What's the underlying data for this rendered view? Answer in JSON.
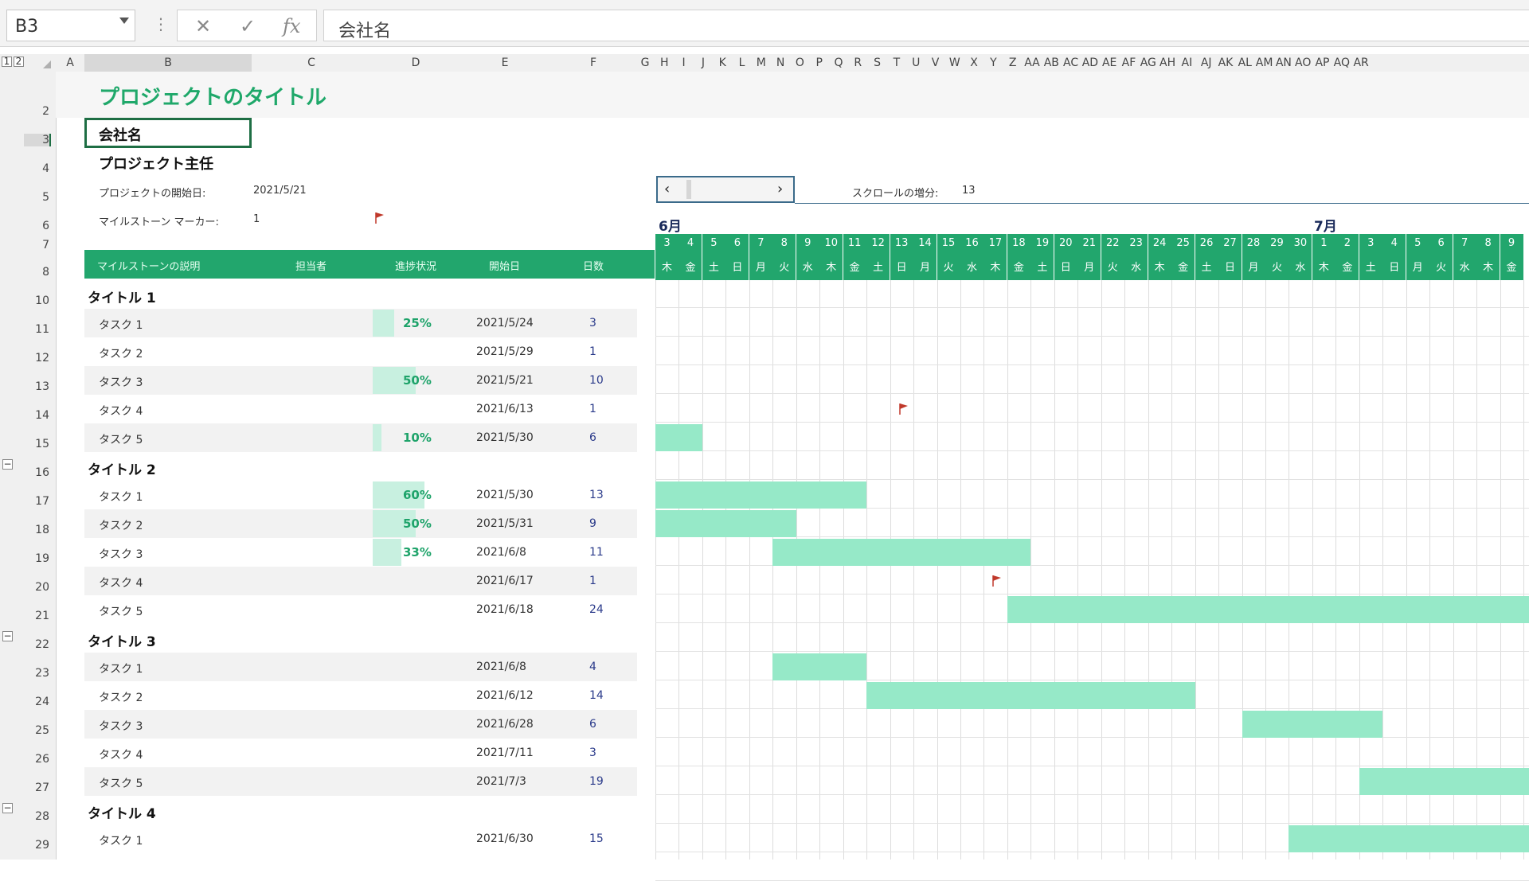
{
  "formula_bar": {
    "name_box": "B3",
    "cancel_glyph": "✕",
    "enter_glyph": "✓",
    "fx_glyph": "fx",
    "content": "会社名"
  },
  "outline_levels": [
    "1",
    "2"
  ],
  "columns_left": [
    "A",
    "B",
    "C",
    "D",
    "E",
    "F"
  ],
  "columns_timeline": [
    "G",
    "H",
    "I",
    "J",
    "K",
    "L",
    "M",
    "N",
    "O",
    "P",
    "Q",
    "R",
    "S",
    "T",
    "U",
    "V",
    "W",
    "X",
    "Y",
    "Z",
    "AA",
    "AB",
    "AC",
    "AD",
    "AE",
    "AF",
    "AG",
    "AH",
    "AI",
    "AJ",
    "AK",
    "AL",
    "AM",
    "AN",
    "AO",
    "AP",
    "AQ",
    "AR"
  ],
  "rows": [
    "2",
    "3",
    "4",
    "5",
    "6",
    "7",
    "8",
    "10",
    "11",
    "12",
    "13",
    "14",
    "15",
    "16",
    "17",
    "18",
    "19",
    "20",
    "21",
    "22",
    "23",
    "24",
    "25",
    "26",
    "27",
    "28",
    "29"
  ],
  "header": {
    "title": "プロジェクトのタイトル",
    "company": "会社名",
    "lead": "プロジェクト主任",
    "start_label": "プロジェクトの開始日:",
    "start_value": "2021/5/21",
    "milestone_label": "マイルストーン マーカー:",
    "milestone_value": "1",
    "scroll_label": "スクロールの増分:",
    "scroll_value": "13"
  },
  "months": [
    "6月",
    "7月"
  ],
  "days": [
    "3",
    "4",
    "5",
    "6",
    "7",
    "8",
    "9",
    "10",
    "11",
    "12",
    "13",
    "14",
    "15",
    "16",
    "17",
    "18",
    "19",
    "20",
    "21",
    "22",
    "23",
    "24",
    "25",
    "26",
    "27",
    "28",
    "29",
    "30",
    "1",
    "2",
    "3",
    "4",
    "5",
    "6",
    "7",
    "8",
    "9"
  ],
  "weekdays": [
    "木",
    "金",
    "土",
    "日",
    "月",
    "火",
    "水",
    "木",
    "金",
    "土",
    "日",
    "月",
    "火",
    "水",
    "木",
    "金",
    "土",
    "日",
    "月",
    "火",
    "水",
    "木",
    "金",
    "土",
    "日",
    "月",
    "火",
    "水",
    "木",
    "金",
    "土",
    "日",
    "月",
    "火",
    "水",
    "木",
    "金"
  ],
  "table_headers": [
    "マイルストーンの説明",
    "担当者",
    "進捗状況",
    "開始日",
    "日数"
  ],
  "sections": [
    {
      "title": "タイトル 1",
      "tasks": [
        {
          "name": "タスク 1",
          "progress": "25%",
          "start": "2021/5/24",
          "days": "3"
        },
        {
          "name": "タスク 2",
          "progress": "",
          "start": "2021/5/29",
          "days": "1"
        },
        {
          "name": "タスク 3",
          "progress": "50%",
          "start": "2021/5/21",
          "days": "10"
        },
        {
          "name": "タスク 4",
          "progress": "",
          "start": "2021/6/13",
          "days": "1"
        },
        {
          "name": "タスク 5",
          "progress": "10%",
          "start": "2021/5/30",
          "days": "6"
        }
      ]
    },
    {
      "title": "タイトル 2",
      "tasks": [
        {
          "name": "タスク 1",
          "progress": "60%",
          "start": "2021/5/30",
          "days": "13"
        },
        {
          "name": "タスク 2",
          "progress": "50%",
          "start": "2021/5/31",
          "days": "9"
        },
        {
          "name": "タスク 3",
          "progress": "33%",
          "start": "2021/6/8",
          "days": "11"
        },
        {
          "name": "タスク 4",
          "progress": "",
          "start": "2021/6/17",
          "days": "1"
        },
        {
          "name": "タスク 5",
          "progress": "",
          "start": "2021/6/18",
          "days": "24"
        }
      ]
    },
    {
      "title": "タイトル 3",
      "tasks": [
        {
          "name": "タスク 1",
          "progress": "",
          "start": "2021/6/8",
          "days": "4"
        },
        {
          "name": "タスク 2",
          "progress": "",
          "start": "2021/6/12",
          "days": "14"
        },
        {
          "name": "タスク 3",
          "progress": "",
          "start": "2021/6/28",
          "days": "6"
        },
        {
          "name": "タスク 4",
          "progress": "",
          "start": "2021/7/11",
          "days": "3"
        },
        {
          "name": "タスク 5",
          "progress": "",
          "start": "2021/7/3",
          "days": "19"
        }
      ]
    },
    {
      "title": "タイトル 4",
      "tasks": [
        {
          "name": "タスク 1",
          "progress": "",
          "start": "2021/6/30",
          "days": "15"
        }
      ]
    }
  ],
  "colors": {
    "accent": "#22a66d",
    "bar": "#96e9c8",
    "flag": "#c0392b"
  }
}
